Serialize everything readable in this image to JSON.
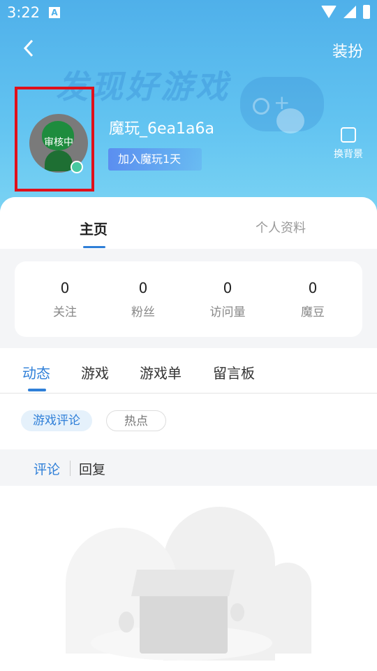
{
  "status_bar": {
    "time": "3:22",
    "notification_icon_letter": "A"
  },
  "nav": {
    "back_label": "<",
    "dress_up_label": "装扮"
  },
  "header": {
    "watermark": "发现好游戏",
    "username": "魔玩_6ea1a6a",
    "join_badge": "加入魔玩1天",
    "avatar_status": "审核中",
    "change_background_label": "换背景"
  },
  "top_tabs": [
    {
      "label": "主页",
      "active": true
    },
    {
      "label": "个人资料",
      "active": false
    }
  ],
  "stats": [
    {
      "value": "0",
      "label": "关注"
    },
    {
      "value": "0",
      "label": "粉丝"
    },
    {
      "value": "0",
      "label": "访问量"
    },
    {
      "value": "0",
      "label": "魔豆"
    }
  ],
  "sub_tabs": [
    {
      "label": "动态",
      "active": true
    },
    {
      "label": "游戏",
      "active": false
    },
    {
      "label": "游戏单",
      "active": false
    },
    {
      "label": "留言板",
      "active": false
    }
  ],
  "chips": [
    {
      "label": "游戏评论",
      "active": true
    },
    {
      "label": "热点",
      "active": false
    }
  ],
  "comment_reply_bar": {
    "comment_label": "评论",
    "reply_label": "回复"
  },
  "colors": {
    "accent": "#2f7fd8",
    "header_blue": "#4fb0ea",
    "highlight_red": "#e0101a"
  }
}
